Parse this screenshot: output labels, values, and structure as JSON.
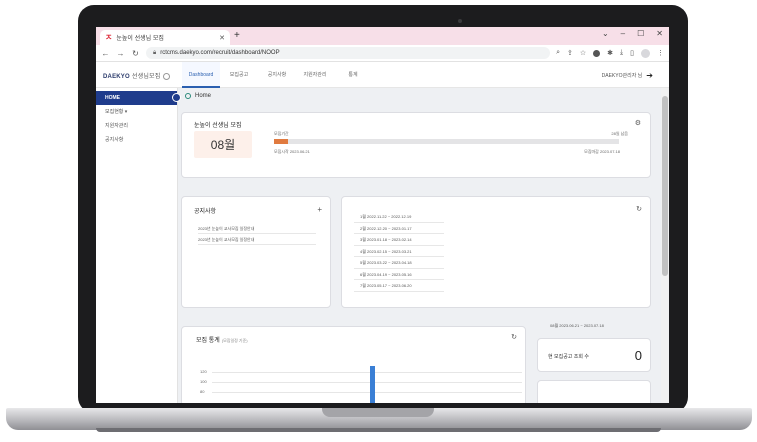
{
  "browser": {
    "tab_title": "눈높이 선생님 모집",
    "url": "rctcms.daekyo.com/recruit/dashboard/NOOP"
  },
  "header": {
    "logo": "DAEKYO",
    "logo_sub": "선생님모집",
    "nav": [
      "Dashboard",
      "모집공고",
      "공지사항",
      "지원자관리",
      "통계"
    ],
    "user": "DAEKYO관리자 님"
  },
  "sidebar": {
    "items": [
      "HOME",
      "모집현황 ▾",
      "지원자관리",
      "공지사항"
    ]
  },
  "breadcrumb": "Home",
  "recruit": {
    "title": "눈높이 선생님 모집",
    "month": "08월",
    "period_label": "모집기간",
    "remaining": "28일 남음",
    "start": "모집시작 2023.06.21",
    "end": "모집마감 2023.07.18",
    "progress": 0.04
  },
  "notice": {
    "title": "공지사항",
    "items": [
      "2023년 눈높이 교사모집 일정안내",
      "2023년 눈높이 교사모집 일정안내"
    ]
  },
  "schedule": {
    "items": [
      "1월  2022.11.22 ~ 2022.12.19",
      "2월  2022.12.20 ~ 2023.01.17",
      "3월  2023.01.18 ~ 2023.02.14",
      "4월  2023.02.15 ~ 2023.03.21",
      "5월  2023.03.22 ~ 2023.04.18",
      "6월  2023.04.19 ~ 2023.05.16",
      "7월  2023.05.17 ~ 2023.06.20"
    ]
  },
  "stats": {
    "title": "모집 통계",
    "condition": "(모집일정 기준)",
    "y_ticks": [
      "120",
      "100",
      "80"
    ],
    "bar_value": 125,
    "y_max": 130
  },
  "summary": {
    "period": "08월   2023.06.21 ~ 2023.07.18",
    "views_label": "현 모집공고 조회 수",
    "views_value": "0"
  },
  "colors": {
    "accent": "#1f3c8c",
    "progress": "#e07a3f",
    "bar": "#3a7fd5"
  }
}
